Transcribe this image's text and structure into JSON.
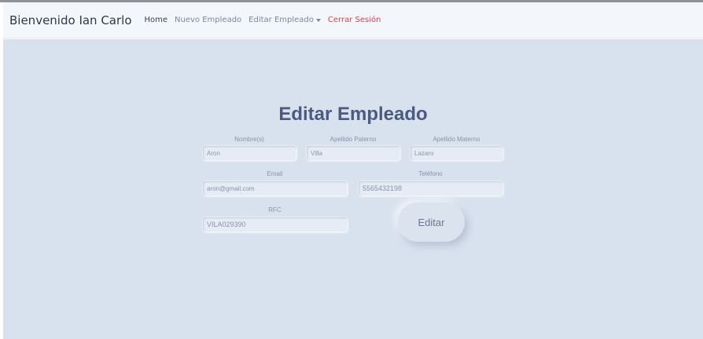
{
  "navbar": {
    "brand": "Bienvenido Ian Carlo",
    "links": [
      {
        "label": "Home"
      },
      {
        "label": "Nuevo Empleado"
      },
      {
        "label": "Editar Empleado"
      },
      {
        "label": "Cerrar Sesión"
      }
    ]
  },
  "form": {
    "title": "Editar Empleado",
    "nombre": {
      "label": "Nombre(s)",
      "value": "Aron"
    },
    "apellido_paterno": {
      "label": "Apellido Paterno",
      "value": "Villa"
    },
    "apellido_materno": {
      "label": "Apellido Materno",
      "value": "Lazaro"
    },
    "email": {
      "label": "Email",
      "value": "aron@gmail.com"
    },
    "telefono": {
      "label": "Teléfono",
      "value": "5565432198"
    },
    "rfc": {
      "label": "RFC",
      "value": "VILA029390"
    },
    "submit_label": "Editar"
  },
  "colors": {
    "background": "#d8e1ee",
    "navbar": "#f3f6fb",
    "title": "#4b5b80",
    "logout": "#d9414b"
  }
}
